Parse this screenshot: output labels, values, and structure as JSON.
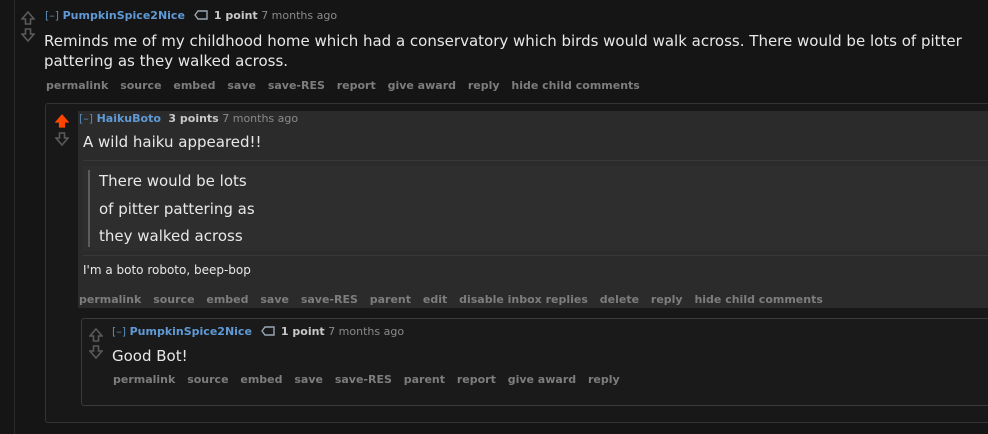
{
  "comment1": {
    "toggle": "[–]",
    "author": "PumpkinSpice2Nice",
    "score": "1 point",
    "time": "7 months ago",
    "body": "Reminds me of my childhood home which had a conservatory which birds would walk across. There would be lots of pitter pattering as they walked across.",
    "actions": [
      "permalink",
      "source",
      "embed",
      "save",
      "save-RES",
      "report",
      "give award",
      "reply",
      "hide child comments"
    ]
  },
  "comment2": {
    "toggle": "[–]",
    "author": "HaikuBoto",
    "score": "3 points",
    "time": "7 months ago",
    "intro": "A wild haiku appeared!!",
    "haiku": [
      "There would be lots",
      "of pitter pattering as",
      "they walked across"
    ],
    "footer": "I'm a boto roboto, beep-bop",
    "actions": [
      "permalink",
      "source",
      "embed",
      "save",
      "save-RES",
      "parent",
      "edit",
      "disable inbox replies",
      "delete",
      "reply",
      "hide child comments"
    ]
  },
  "comment3": {
    "toggle": "[–]",
    "author": "PumpkinSpice2Nice",
    "score": "1 point",
    "time": "7 months ago",
    "body": "Good Bot!",
    "actions": [
      "permalink",
      "source",
      "embed",
      "save",
      "save-RES",
      "parent",
      "report",
      "give award",
      "reply"
    ]
  },
  "colors": {
    "background": "#151515",
    "upvoted": "#ff4500",
    "author": "#5f9ad6",
    "action": "#7d7d7d"
  },
  "icons": [
    "upvote-arrow-icon",
    "downvote-arrow-icon",
    "award-icon"
  ]
}
